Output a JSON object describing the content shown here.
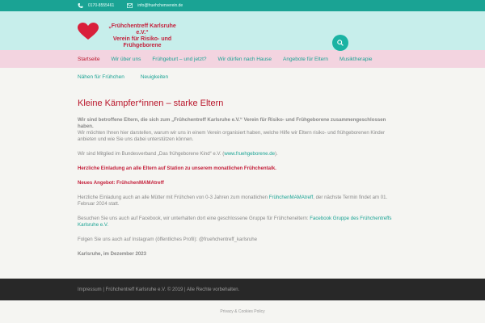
{
  "colors": {
    "teal": "#1aa394",
    "red": "#c41f3a",
    "header_bg": "#c7eeeb",
    "nav_bg": "#f3d4e0",
    "footer_bg": "#282828"
  },
  "topbar": {
    "phone": "0170-8555461",
    "email": "info@fruehchenverein.de",
    "phone_icon": "phone-icon",
    "mail_icon": "mail-icon"
  },
  "logo": {
    "line1": "„Frühchentreff Karlsruhe e.V.“",
    "line2": "Verein für Risiko- und",
    "line3": "Frühgeborene"
  },
  "nav": {
    "row1": [
      "Startseite",
      "Wir über uns",
      "Frühgeburt – und jetzt?",
      "Wir dürfen nach Hause",
      "Angebote für Eltern",
      "Musiktherapie"
    ],
    "row2": [
      "Nähen für Frühchen",
      "Neuigkeiten"
    ]
  },
  "content": {
    "title": "Kleine Kämpfer*innen – starke Eltern",
    "p1_bold": "Wir sind betroffene Eltern, die sich zum „Frühchentreff Karlsruhe e.V.“ Verein für Risiko- und Frühgeborene zusammengeschlossen haben.",
    "p1_text": "Wir möchten Ihnen hier darstellen, warum wir uns in einem Verein organisiert haben, welche Hilfe wir Eltern risiko- und frühgeborenen Kinder anbieten und wie Sie uns dabei unterstützen können.",
    "p2_text": "Wir sind Mitglied im Bundesverband „Das frühgeborene Kind“ e.V. (",
    "p2_link": "www.fruehgeborene.de",
    "p2_end": ").",
    "invite": "Herzliche Einladung an alle Eltern auf Station zu unserem monatlichen Frühchentalk.",
    "new_offer": "Neues Angebot: FrühchenMAMAtreff",
    "p3_text": "Herzliche Einladung auch an alle Mütter mit Frühchen von 0-3 Jahren zum monatlichen ",
    "p3_link": "FrühchenMAMAtreff",
    "p3_end": ", der nächste Termin findet am 01. Februar 2024 statt.",
    "p4_text": "Besuchen Sie uns auch auf Facebook, wir unterhalten dort eine geschlossene Gruppe für Frühcheneltern: ",
    "p4_link": "Facebook Gruppe des Frühchentreffs Karlsruhe e.V.",
    "p5_text": "Folgen Sie uns auch auf Instagram (öffentliches Profil): @fruehchentreff_karlsruhe",
    "signature": "Karlsruhe, im Dezember 2023"
  },
  "footer": {
    "text": "Impressum | Frühchentreff Karlsruhe e.V. © 2019 | Alle Rechte vorbehalten."
  },
  "bottom": {
    "privacy": "Privacy & Cookies Policy"
  }
}
